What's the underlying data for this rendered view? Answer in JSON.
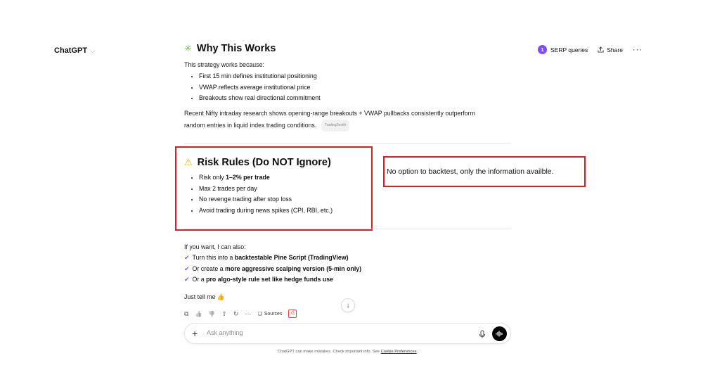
{
  "header": {
    "model_name": "ChatGPT",
    "chevron": "⌵",
    "serp_badge": "1",
    "serp_label": "SERP queries",
    "share_label": "Share",
    "more_label": "···"
  },
  "why": {
    "emoji": "✳",
    "title": "Why This Works",
    "intro": "This strategy works because:",
    "bullets": [
      "First 15 min defines institutional positioning",
      "VWAP reflects average institutional price",
      "Breakouts show real directional commitment"
    ],
    "research_line1": "Recent Nifty intraday research shows opening-range breakouts + VWAP pullbacks consistently outperform",
    "research_line2": "random entries in liquid index trading conditions.",
    "citation": "TradingZenith"
  },
  "risk": {
    "emoji": "⚠",
    "title": "Risk Rules (Do NOT Ignore)",
    "b1_prefix": "Risk only ",
    "b1_bold": "1–2% per trade",
    "bullets": [
      "Max 2 trades per day",
      "No revenge trading after stop loss",
      "Avoid trading during news spikes (CPI, RBI, etc.)"
    ]
  },
  "annotation": {
    "note": "No option to backtest, only the information availble.",
    "box_color": "#d81f26"
  },
  "followup": {
    "intro": "If you want, I can also:",
    "check": "✔",
    "items": [
      {
        "prefix": "Turn this into a ",
        "bold": "backtestable Pine Script (TradingView)"
      },
      {
        "prefix": "Or create a ",
        "bold": "more aggressive scalping version (5-min only)"
      },
      {
        "prefix": "Or a ",
        "bold": "pro algo-style rule set like hedge funds use"
      }
    ],
    "closing": "Just tell me 👍"
  },
  "actions": {
    "copy": "⧉",
    "like": "👍",
    "dislike": "👎",
    "share": "⇧",
    "regenerate": "↻",
    "more": "···",
    "sources_label": "Sources",
    "sources_icon": "❏",
    "search_icon": "G"
  },
  "scroll_down": "↓",
  "composer": {
    "plus": "+",
    "placeholder": "Ask anything"
  },
  "footer": {
    "disclaimer": "ChatGPT can make mistakes. Check important info. See ",
    "link": "Cookie Preferences",
    "period": "."
  },
  "colors": {
    "accent": "#7c4dff",
    "annotation_red": "#d81f26",
    "check_purple": "#7c5cd6"
  }
}
